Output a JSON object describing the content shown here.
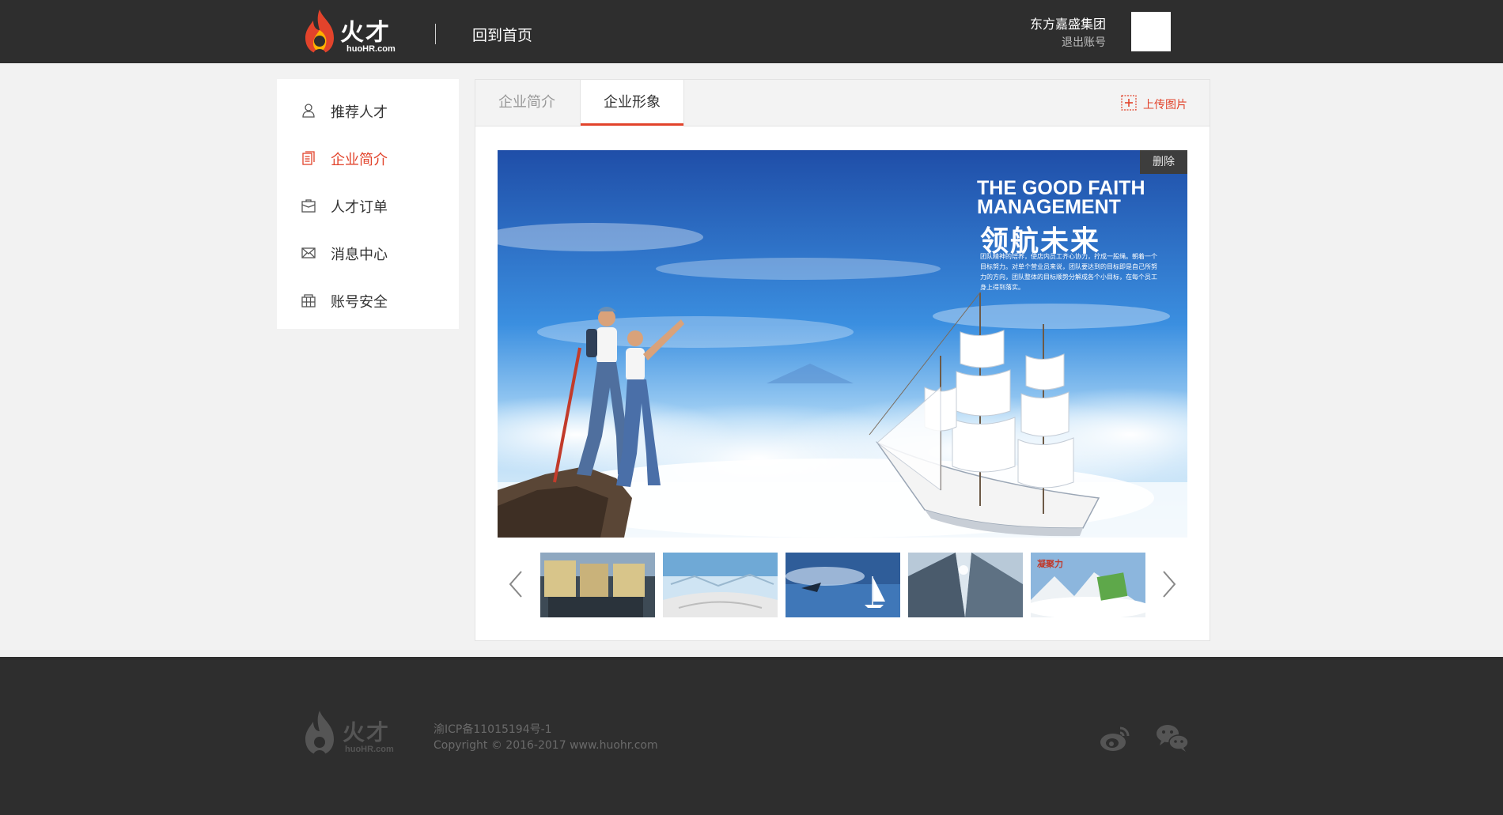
{
  "header": {
    "logo_text": "火才",
    "logo_sub": "huoHR.com",
    "home_link": "回到首页",
    "company_name": "东方嘉盛集团",
    "logout": "退出账号"
  },
  "sidebar": {
    "items": [
      {
        "label": "推荐人才",
        "icon": "user-icon",
        "active": false
      },
      {
        "label": "企业简介",
        "icon": "document-icon",
        "active": true
      },
      {
        "label": "人才订单",
        "icon": "briefcase-icon",
        "active": false
      },
      {
        "label": "消息中心",
        "icon": "mail-icon",
        "active": false
      },
      {
        "label": "账号安全",
        "icon": "building-icon",
        "active": false
      }
    ]
  },
  "main": {
    "tabs": [
      {
        "label": "企业简介",
        "active": false
      },
      {
        "label": "企业形象",
        "active": true
      }
    ],
    "upload_label": "上传图片",
    "delete_label": "删除",
    "image": {
      "title": "THE GOOD FAITH MANAGEMENT",
      "title_cn": "领航未来",
      "desc": "团队精神的培养，使店内员工齐心协力，拧成一股绳。朝着一个目标努力。对单个营业员来说，团队要达到的目标即是自己所努力的方向，团队整体的目标顺势分解成各个小目标，在每个员工身上得到落实。"
    },
    "thumbnails": [
      "团队",
      "sky-paper",
      "sea-sail",
      "skyscrapers",
      "cohesion"
    ]
  },
  "footer": {
    "logo_text": "火才",
    "logo_sub": "huoHR.com",
    "icp": "渝ICP备11015194号-1",
    "copyright": "Copyright © 2016-2017 www.huohr.com"
  },
  "colors": {
    "accent": "#e2432b",
    "header_bg": "#2e2e2e",
    "page_bg": "#f2f2f2"
  }
}
